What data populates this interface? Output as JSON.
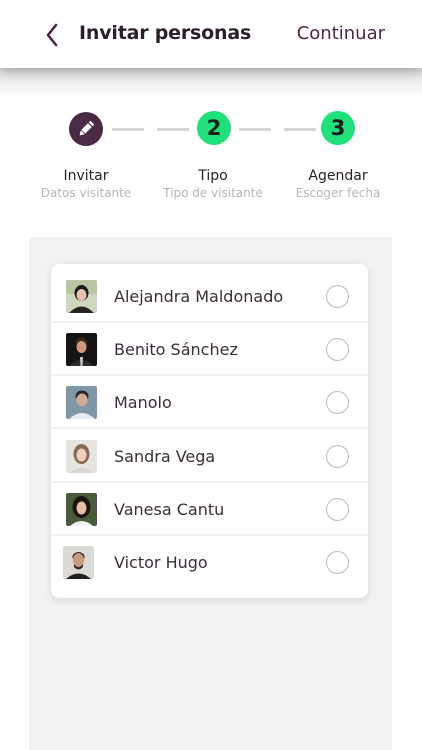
{
  "header": {
    "title": "Invitar personas",
    "continue_label": "Continuar",
    "back_icon": "chevron-left-icon",
    "accent": "#4a2a45"
  },
  "stepper": {
    "steps": [
      {
        "label": "Invitar",
        "sub": "Datos visitante",
        "icon": "pencil-icon",
        "state": "done"
      },
      {
        "label": "Tipo",
        "sub": "Tipo de visitante",
        "number": "2",
        "state": "next"
      },
      {
        "label": "Agendar",
        "sub": "Escoger fecha",
        "number": "3",
        "state": "next"
      }
    ],
    "colors": {
      "done": "#4a2a45",
      "next": "#1fe07a",
      "dash": "#d6d6d6"
    }
  },
  "people": [
    {
      "name": "Alejandra Maldonado",
      "avatar": "person-photo",
      "selected": false
    },
    {
      "name": "Benito Sánchez",
      "avatar": "person-photo",
      "selected": false
    },
    {
      "name": "Manolo",
      "avatar": "person-photo",
      "selected": false
    },
    {
      "name": "Sandra Vega",
      "avatar": "person-photo",
      "selected": false
    },
    {
      "name": "Vanesa Cantu",
      "avatar": "person-photo",
      "selected": false
    },
    {
      "name": "Victor Hugo",
      "avatar": "person-photo",
      "selected": false
    }
  ]
}
